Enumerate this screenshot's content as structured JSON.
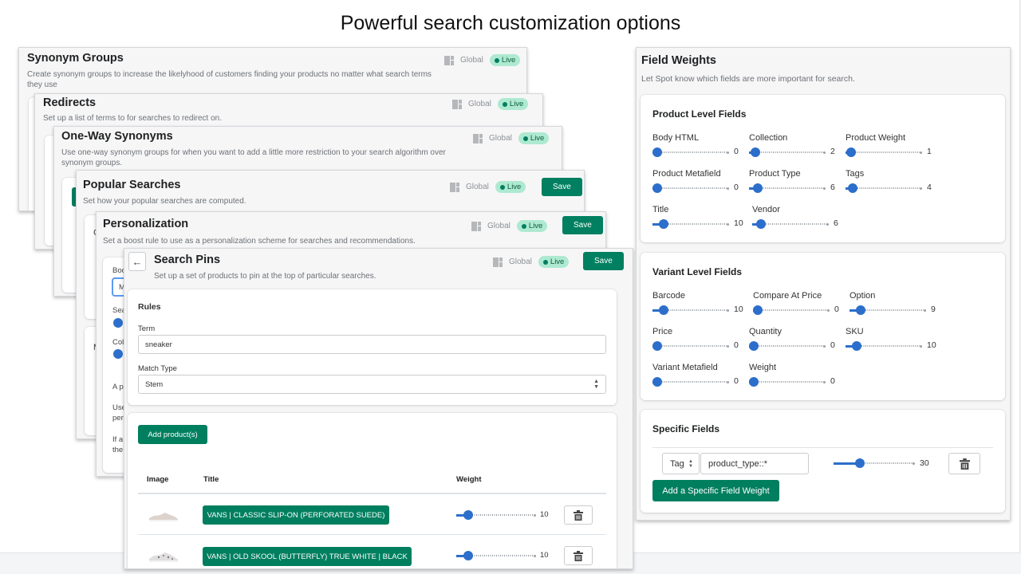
{
  "headline": "Powerful search customization options",
  "common": {
    "global_label": "Global",
    "live_label": "Live",
    "save_label": "Save"
  },
  "panels": {
    "synonym_groups": {
      "title": "Synonym Groups",
      "desc": "Create synonym groups to increase the likelyhood of customers finding your products no matter what search terms they use"
    },
    "redirects": {
      "title": "Redirects",
      "desc": "Set up a list of terms to for searches to redirect on."
    },
    "one_way": {
      "title": "One-Way Synonyms",
      "desc": "Use one-way synonym groups for when you want to add a little more restriction to your search algorithm over synonym groups."
    },
    "popular": {
      "title": "Popular Searches",
      "desc": "Set how your popular searches are computed.",
      "ghost_c": "C",
      "ghost_m": "M"
    },
    "personalization": {
      "title": "Personalization",
      "desc": "Set a boost rule to use as a personalization scheme for searches and recommendations.",
      "ghost": [
        "Boo",
        "M",
        "Sea",
        "Col",
        "A p",
        "Use",
        "per",
        "If a",
        "the"
      ]
    }
  },
  "search_pins": {
    "title": "Search Pins",
    "desc": "Set up a set of products to pin at the top of particular searches.",
    "rules_heading": "Rules",
    "term_label": "Term",
    "term_value": "sneaker",
    "match_type_label": "Match Type",
    "match_type_value": "Stem",
    "add_products_label": "Add product(s)",
    "columns": [
      "Image",
      "Title",
      "Weight"
    ],
    "products": [
      {
        "title": "VANS | CLASSIC SLIP-ON (PERFORATED SUEDE)",
        "weight": 10,
        "weight_max": 100
      },
      {
        "title": "VANS | OLD SKOOL (BUTTERFLY) TRUE WHITE | BLACK",
        "weight": 10,
        "weight_max": 100
      }
    ]
  },
  "field_weights": {
    "title": "Field Weights",
    "desc": "Let Spot know which fields are more important for search.",
    "slider_max": 100,
    "product_level": {
      "heading": "Product Level Fields",
      "fields": [
        {
          "label": "Body HTML",
          "value": 0
        },
        {
          "label": "Collection",
          "value": 2
        },
        {
          "label": "Product Weight",
          "value": 1
        },
        {
          "label": "Product Metafield",
          "value": 0
        },
        {
          "label": "Product Type",
          "value": 6
        },
        {
          "label": "Tags",
          "value": 4
        },
        {
          "label": "Title",
          "value": 10
        },
        {
          "label": "Vendor",
          "value": 6
        }
      ]
    },
    "variant_level": {
      "heading": "Variant Level Fields",
      "fields": [
        {
          "label": "Barcode",
          "value": 10
        },
        {
          "label": "Compare At Price",
          "value": 0
        },
        {
          "label": "Option",
          "value": 9
        },
        {
          "label": "Price",
          "value": 0
        },
        {
          "label": "Quantity",
          "value": 0
        },
        {
          "label": "SKU",
          "value": 10
        },
        {
          "label": "Variant Metafield",
          "value": 0
        },
        {
          "label": "Weight",
          "value": 0
        }
      ]
    },
    "specific": {
      "heading": "Specific Fields",
      "type_value": "Tag",
      "field_value": "product_type::*",
      "weight": 30,
      "weight_max": 100,
      "add_label": "Add a Specific Field Weight"
    }
  },
  "colors": {
    "primary_green": "#007f5f",
    "slider_blue": "#2c6ecb",
    "live_bg": "#aee9d1"
  }
}
